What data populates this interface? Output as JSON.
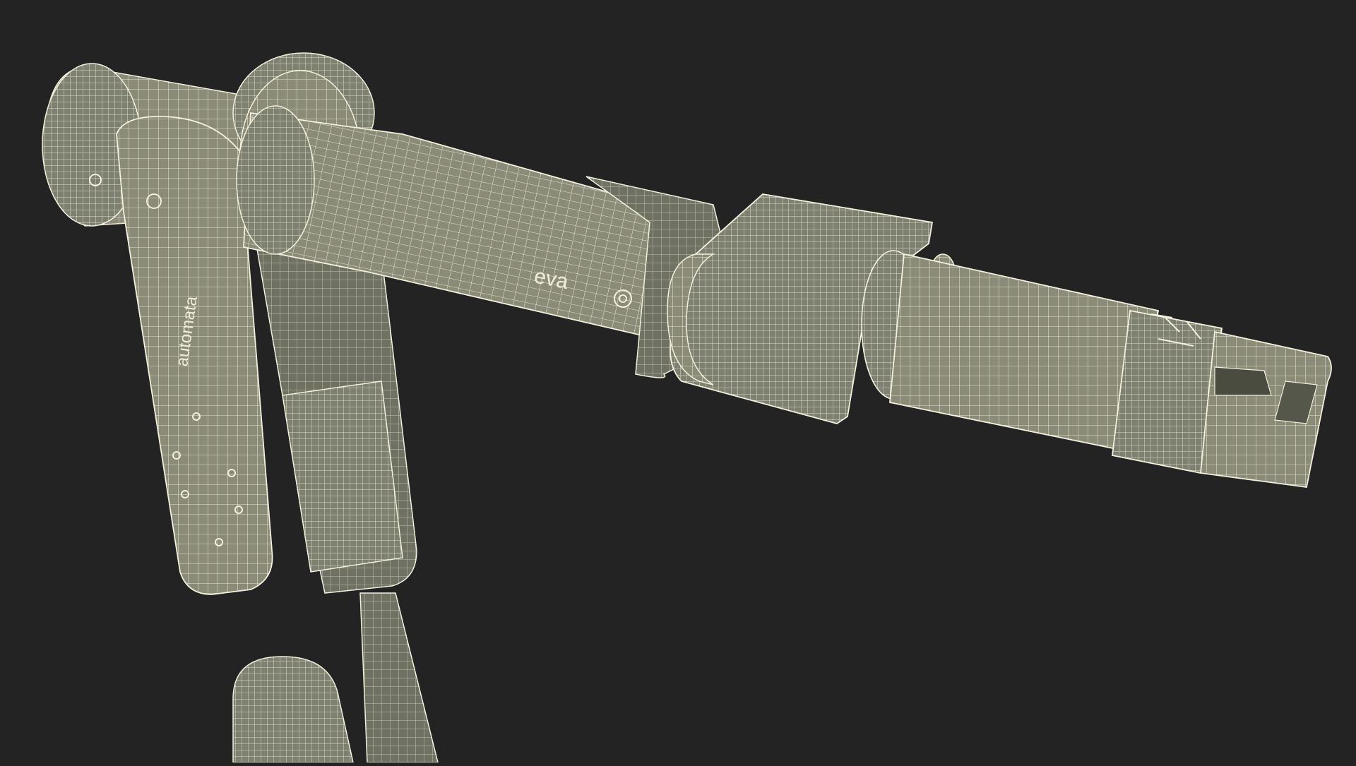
{
  "scene": {
    "subject": "robotic-arm-wireframe",
    "render_mode": "wireframe",
    "background_color": "#232323",
    "surface_color": "#8a8c78",
    "shade_color": "#6f7262",
    "wire_color": "#f2f0dc"
  },
  "labels": {
    "brand_on_upper_link": "automata",
    "brand_on_forearm": "eva"
  }
}
